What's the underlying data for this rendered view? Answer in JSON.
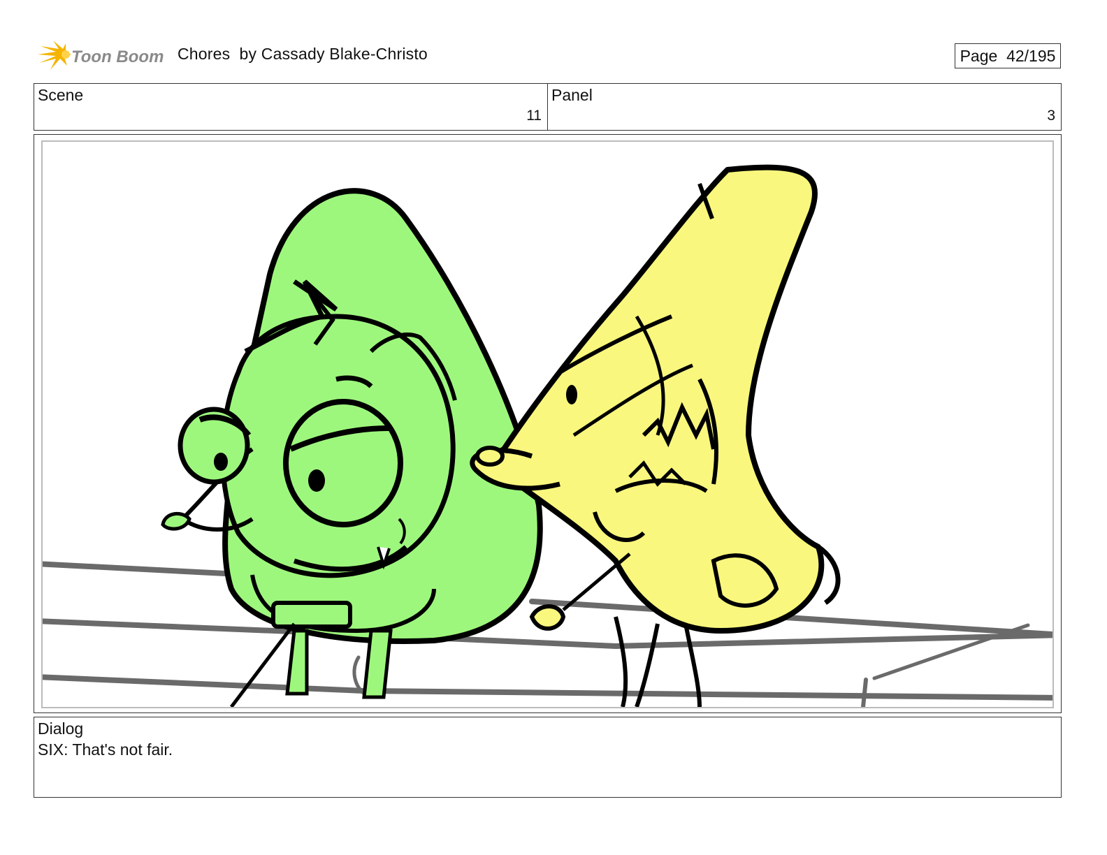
{
  "header": {
    "logo_text": "Toon Boom",
    "title": "Chores  by Cassady Blake-Christo",
    "page_label": "Page  42/195"
  },
  "scene": {
    "label": "Scene",
    "value": "11"
  },
  "panel": {
    "label": "Panel",
    "value": "3"
  },
  "dialog": {
    "label": "Dialog",
    "text": "SIX: That's not fair."
  },
  "colors": {
    "logo_flare": "#f5b400",
    "logo_text": "#8a8a8a",
    "green_character": "#9ef77d",
    "yellow_character": "#f9f77d",
    "rails": "#6a6a6a",
    "ink": "#000000"
  }
}
